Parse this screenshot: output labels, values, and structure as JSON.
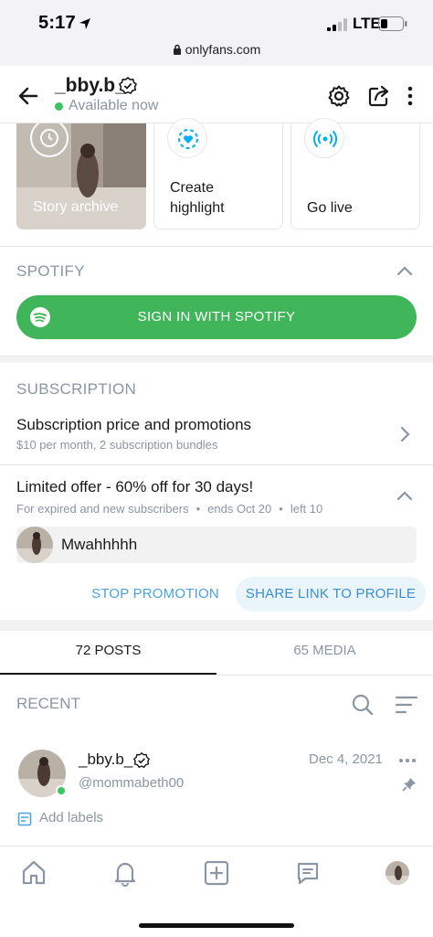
{
  "status_bar": {
    "time": "5:17",
    "network": "LTE",
    "url": "onlyfans.com"
  },
  "header": {
    "username": "_bby.b_",
    "status": "Available now"
  },
  "highlights": [
    {
      "label": "Story archive"
    },
    {
      "label_line1": "Create",
      "label_line2": "highlight"
    },
    {
      "label": "Go live"
    }
  ],
  "spotify": {
    "title": "SPOTIFY",
    "button_label": "SIGN IN WITH SPOTIFY"
  },
  "subscription": {
    "title": "SUBSCRIPTION",
    "row_title": "Subscription price and promotions",
    "row_desc": "$10 per month, 2 subscription bundles",
    "offer_title": "Limited offer - 60% off for 30 days!",
    "offer_audience": "For expired and new subscribers",
    "offer_ends": "ends Oct 20",
    "offer_left": "left 10",
    "offer_message": "Mwahhhhh",
    "stop_label": "STOP PROMOTION",
    "share_label": "SHARE LINK TO PROFILE"
  },
  "tabs": [
    {
      "label": "72 POSTS",
      "active": true
    },
    {
      "label": "65 MEDIA",
      "active": false
    }
  ],
  "recent": {
    "title": "RECENT"
  },
  "post": {
    "name": "_bby.b_",
    "handle": "@mommabeth00",
    "date": "Dec 4, 2021",
    "add_labels": "Add labels"
  },
  "colors": {
    "accent": "#00aff0",
    "spotify": "#41b55a",
    "online": "#3cc464",
    "muted": "#8a96a3"
  },
  "icons": {
    "header": [
      "back-arrow-icon",
      "verified-icon",
      "gear-icon",
      "share-icon",
      "more-vertical-icon"
    ],
    "nav": [
      "home-icon",
      "bell-icon",
      "plus-square-icon",
      "message-icon",
      "avatar"
    ]
  }
}
